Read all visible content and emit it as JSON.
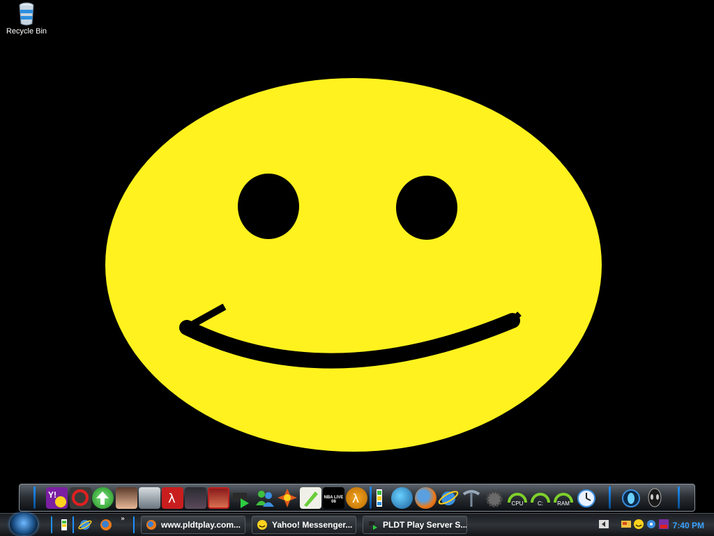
{
  "desktop": {
    "icons": [
      {
        "label": "Recycle Bin",
        "icon": "recycle-bin-icon"
      }
    ],
    "wallpaper": "smiley-face"
  },
  "dock": {
    "icons": [
      "yahoo-messenger-icon",
      "garena-icon",
      "update-arrow-icon",
      "anime-avatar-icon",
      "racing-game-icon",
      "half-life-icon",
      "dark-game-icon",
      "warrior-game-icon",
      "media-player-icon",
      "msn-messenger-icon",
      "target-game-icon",
      "pen-tool-icon",
      "nba-live-icon",
      "half-life-2-icon",
      "rocketdock-icon",
      "globe-icon",
      "firefox-icon",
      "internet-explorer-icon",
      "pickaxe-icon",
      "settings-gear-icon",
      "cpu-gauge-icon",
      "drive-gauge-icon",
      "ram-gauge-icon",
      "clock-icon",
      "alienware-icon",
      "alien-head-icon"
    ],
    "labels": {
      "nba": "NBA LIVE 08",
      "cpu": "CPU",
      "drive": "C:",
      "ram": "RAM"
    }
  },
  "taskbar": {
    "tasks": [
      {
        "label": "www.pldtplay.com...",
        "icon": "firefox-icon"
      },
      {
        "label": "Yahoo! Messenger...",
        "icon": "yahoo-smiley-icon"
      },
      {
        "label": "PLDT Play Server S...",
        "icon": "server-icon"
      }
    ],
    "clock": "7:40 PM"
  },
  "colors": {
    "accent": "#1e90ff",
    "smiley": "#fff21e",
    "clock": "#3aa3ff"
  }
}
